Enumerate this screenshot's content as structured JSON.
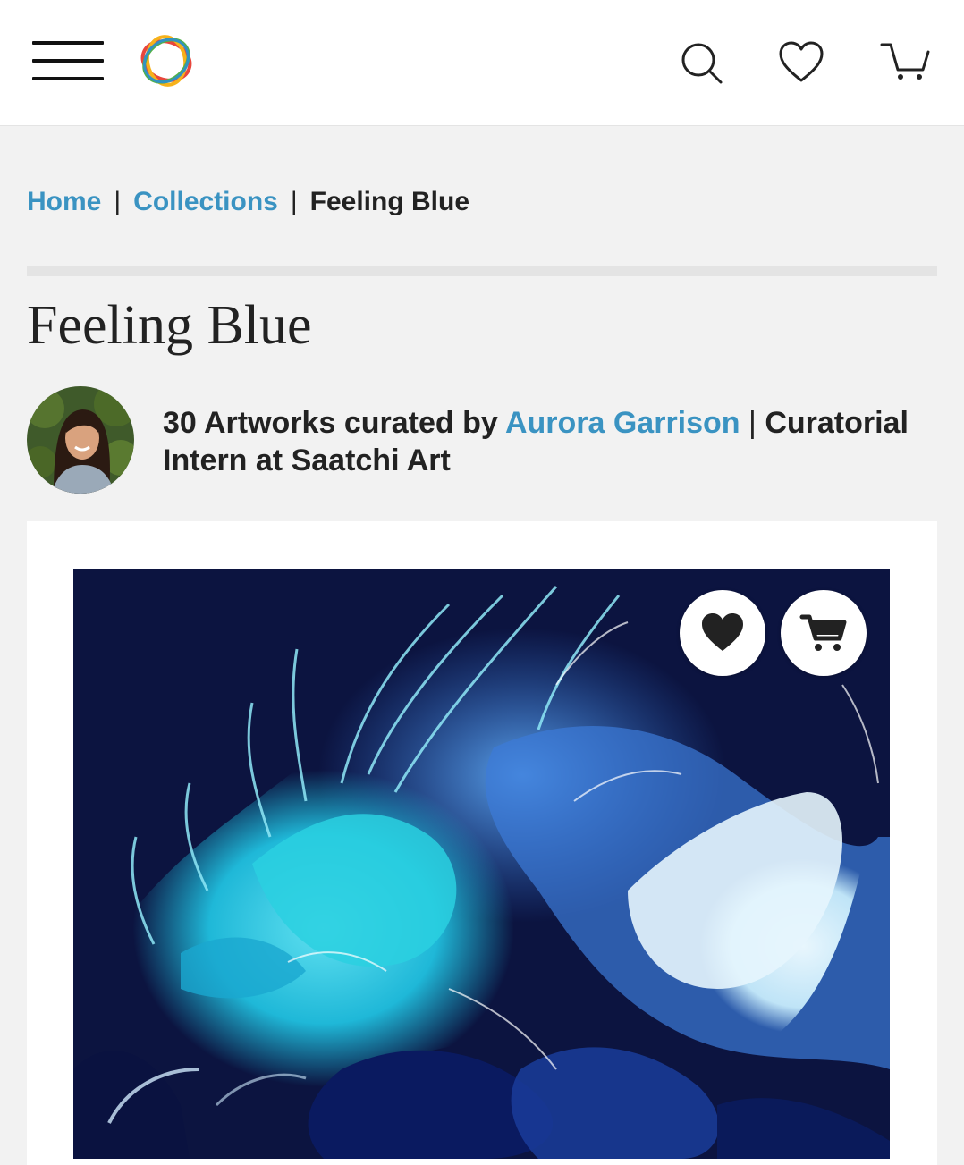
{
  "header": {
    "menu_icon": "hamburger-menu-icon",
    "logo_icon": "saatchi-art-logo",
    "search_icon": "search-icon",
    "favorites_icon": "heart-outline-icon",
    "cart_icon": "cart-icon"
  },
  "breadcrumb": {
    "items": [
      {
        "label": "Home"
      },
      {
        "label": "Collections"
      }
    ],
    "separator": "|",
    "current": "Feeling Blue"
  },
  "collection": {
    "title": "Feeling Blue",
    "count_text": "30 Artworks curated by ",
    "curator_name": "Aurora Garrison",
    "separator": "|",
    "curator_role": " Curatorial Intern at Saatchi Art"
  },
  "artwork_card": {
    "favorite_icon": "heart-filled-icon",
    "cart_icon": "cart-filled-icon"
  },
  "colors": {
    "link": "#3a93c2",
    "text": "#222222",
    "background": "#f2f2f2",
    "card": "#ffffff"
  }
}
